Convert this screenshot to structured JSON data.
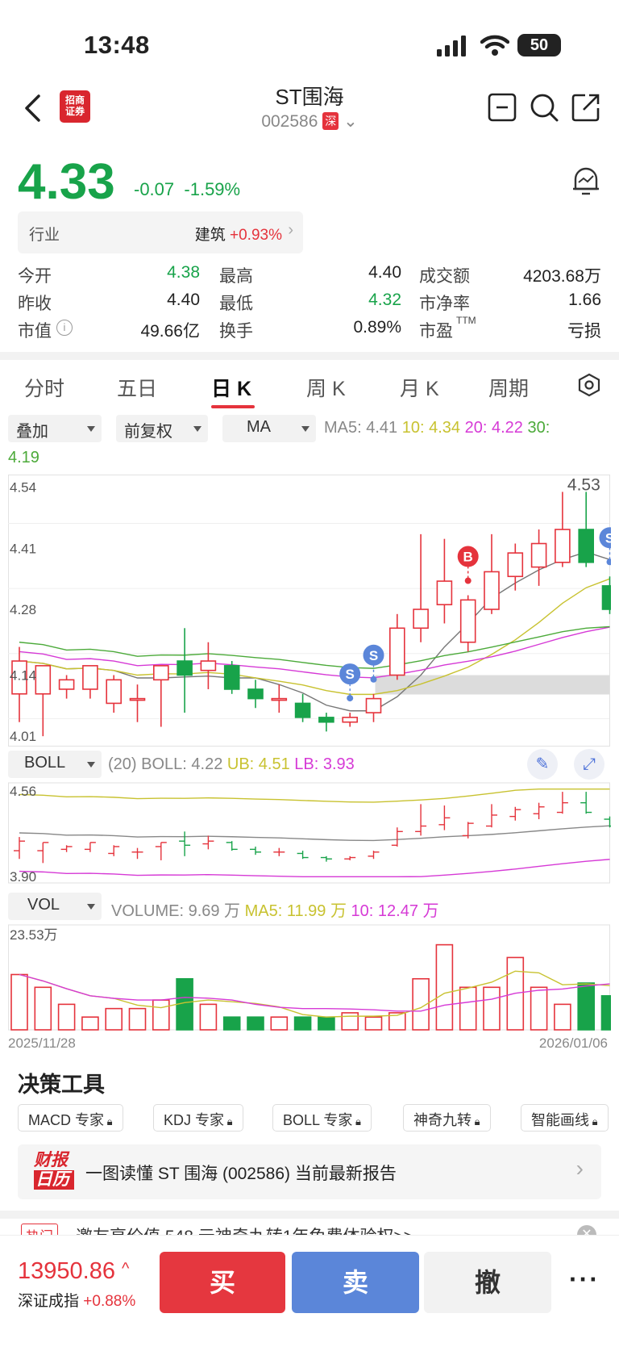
{
  "status": {
    "time": "13:48",
    "battery": "50"
  },
  "header": {
    "title": "ST围海",
    "code": "002586",
    "market": "深",
    "logo_text": "招商证券"
  },
  "quote": {
    "price": "4.33",
    "change": "-0.07",
    "change_pct": "-1.59%",
    "industry_label": "行业",
    "industry_name": "建筑",
    "industry_change": "+0.93%",
    "fields": [
      {
        "label": "今开",
        "value": "4.38",
        "color": "#18a34a"
      },
      {
        "label": "最高",
        "value": "4.40",
        "color": "#222222"
      },
      {
        "label": "成交额",
        "value": "4203.68万",
        "color": "#222222"
      },
      {
        "label": "昨收",
        "value": "4.40",
        "color": "#222222"
      },
      {
        "label": "最低",
        "value": "4.32",
        "color": "#18a34a"
      },
      {
        "label": "市净率",
        "value": "1.66",
        "color": "#222222"
      },
      {
        "label": "市值",
        "value": "49.66亿",
        "color": "#222222"
      },
      {
        "label": "换手",
        "value": "0.89%",
        "color": "#222222"
      },
      {
        "label": "市盈",
        "value": "亏损",
        "color": "#222222"
      }
    ],
    "pe_suffix": "TTM"
  },
  "tabs": [
    "分时",
    "五日",
    "日 K",
    "周 K",
    "月 K",
    "周期"
  ],
  "active_tab": "日 K",
  "controls": {
    "overlay": "叠加",
    "adjust": "前复权",
    "indicator": "MA"
  },
  "ma_line": {
    "ma5": "MA5: 4.41",
    "ma10": "10: 4.34",
    "ma20": "20: 4.22",
    "ma30": "30:",
    "ma30_val": "4.19"
  },
  "boll_line": {
    "selector": "BOLL",
    "period": "(20)",
    "boll": "BOLL: 4.22",
    "ub": "UB: 4.51",
    "lb": "LB: 3.93"
  },
  "vol_line": {
    "selector": "VOL",
    "volume": "VOLUME: 9.69 万",
    "ma5": "MA5: 11.99 万",
    "ma10": "10: 12.47 万"
  },
  "chart_data": {
    "type": "candlestick",
    "dates": [
      "2025/11/28",
      "2026/01/06"
    ],
    "main_axis": {
      "labels": [
        "4.54",
        "4.41",
        "4.28",
        "4.14",
        "4.01"
      ],
      "max_label": "4.53"
    },
    "candles": [
      {
        "o": 4.1,
        "c": 4.17,
        "h": 4.2,
        "l": 4.04
      },
      {
        "o": 4.1,
        "c": 4.16,
        "h": 4.16,
        "l": 4.01
      },
      {
        "o": 4.11,
        "c": 4.13,
        "h": 4.14,
        "l": 4.09
      },
      {
        "o": 4.11,
        "c": 4.16,
        "h": 4.16,
        "l": 4.09
      },
      {
        "o": 4.08,
        "c": 4.13,
        "h": 4.14,
        "l": 4.06
      },
      {
        "o": 4.09,
        "c": 4.09,
        "h": 4.12,
        "l": 4.04
      },
      {
        "o": 4.13,
        "c": 4.16,
        "h": 4.16,
        "l": 4.03
      },
      {
        "o": 4.17,
        "c": 4.14,
        "h": 4.24,
        "l": 4.06
      },
      {
        "o": 4.15,
        "c": 4.17,
        "h": 4.21,
        "l": 4.11
      },
      {
        "o": 4.16,
        "c": 4.11,
        "h": 4.17,
        "l": 4.1
      },
      {
        "o": 4.11,
        "c": 4.09,
        "h": 4.13,
        "l": 4.07
      },
      {
        "o": 4.09,
        "c": 4.09,
        "h": 4.12,
        "l": 4.06
      },
      {
        "o": 4.08,
        "c": 4.05,
        "h": 4.1,
        "l": 4.04
      },
      {
        "o": 4.05,
        "c": 4.04,
        "h": 4.06,
        "l": 4.02
      },
      {
        "o": 4.04,
        "c": 4.05,
        "h": 4.06,
        "l": 4.03
      },
      {
        "o": 4.06,
        "c": 4.09,
        "h": 4.1,
        "l": 4.04
      },
      {
        "o": 4.14,
        "c": 4.24,
        "h": 4.27,
        "l": 4.13
      },
      {
        "o": 4.24,
        "c": 4.28,
        "h": 4.44,
        "l": 4.21
      },
      {
        "o": 4.29,
        "c": 4.34,
        "h": 4.43,
        "l": 4.25
      },
      {
        "o": 4.21,
        "c": 4.3,
        "h": 4.31,
        "l": 4.19
      },
      {
        "o": 4.28,
        "c": 4.36,
        "h": 4.44,
        "l": 4.27
      },
      {
        "o": 4.35,
        "c": 4.4,
        "h": 4.42,
        "l": 4.32
      },
      {
        "o": 4.37,
        "c": 4.42,
        "h": 4.45,
        "l": 4.33
      },
      {
        "o": 4.38,
        "c": 4.45,
        "h": 4.53,
        "l": 4.37
      },
      {
        "o": 4.45,
        "c": 4.38,
        "h": 4.53,
        "l": 4.37
      },
      {
        "o": 4.33,
        "c": 4.28,
        "h": 4.35,
        "l": 4.27
      }
    ],
    "markers": [
      {
        "index": 14,
        "label": "S"
      },
      {
        "index": 15,
        "label": "S"
      },
      {
        "index": 19,
        "label": "B"
      },
      {
        "index": 25,
        "label": "S"
      }
    ],
    "boll_axis": {
      "labels": [
        "4.56",
        "3.90"
      ]
    },
    "vol_axis": {
      "labels": [
        "23.53万"
      ]
    },
    "volumes": [
      13,
      10,
      6,
      3,
      5,
      5,
      7,
      12,
      6,
      3,
      3,
      3,
      3,
      3,
      4,
      3,
      4,
      12,
      20,
      10,
      10,
      17,
      10,
      6,
      11,
      8
    ],
    "colors": {
      "up": "#e5333c",
      "down": "#18a34a",
      "ma5": "#777777",
      "ma10": "#c8c230",
      "ma20": "#d63ad6",
      "ma30": "#4caa3a"
    }
  },
  "tools": {
    "title": "决策工具",
    "chips": [
      "MACD 专家",
      "KDJ 专家",
      "BOLL 专家",
      "神奇九转",
      "智能画线"
    ]
  },
  "report": {
    "badge_top": "财报",
    "badge_bottom": "日历",
    "text": "一图读懂 ST 围海 (002586) 当前最新报告"
  },
  "promo": {
    "tag": "热门",
    "text": "邀友享价值 548 元神奇九转1年免费体验权>>"
  },
  "bottom": {
    "index_value": "13950.86",
    "index_name": "深证成指",
    "index_change": "+0.88%",
    "buy": "买",
    "sell": "卖",
    "cancel": "撤"
  }
}
